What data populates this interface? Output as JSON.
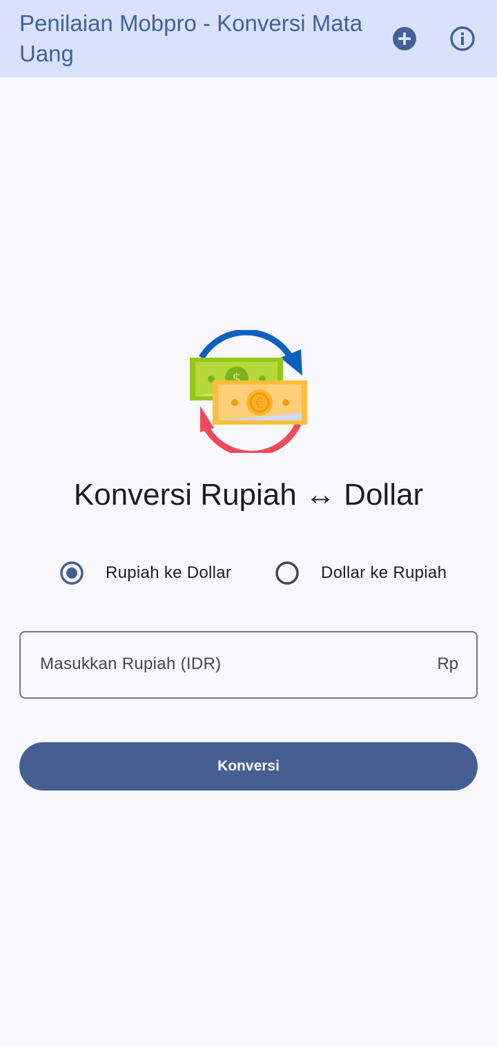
{
  "app_bar": {
    "title": "Penilaian Mobpro - Konversi Mata Uang",
    "actions": [
      {
        "icon": "add-circle-icon"
      },
      {
        "icon": "info-icon"
      }
    ]
  },
  "illustration": {
    "icon": "currency-exchange-illustration"
  },
  "heading": "Konversi Rupiah ↔ Dollar",
  "conversion_mode": {
    "options": [
      {
        "label": "Rupiah ke Dollar",
        "selected": true
      },
      {
        "label": "Dollar ke Rupiah",
        "selected": false
      }
    ]
  },
  "amount_input": {
    "placeholder": "Masukkan Rupiah (IDR)",
    "value": "",
    "suffix": "Rp"
  },
  "convert_button": {
    "label": "Konversi"
  },
  "colors": {
    "app_bar_bg": "#d8e2fb",
    "primary": "#455f93",
    "background": "#f9f8fd",
    "on_surface": "#1b1b21"
  }
}
